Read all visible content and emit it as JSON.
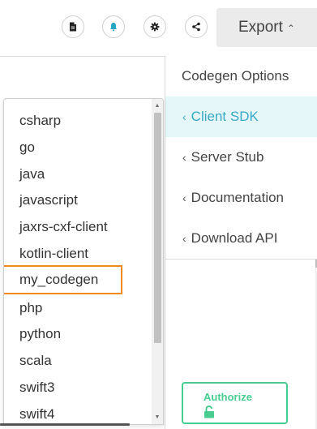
{
  "toolbar": {
    "icons": [
      "document-icon",
      "bell-icon",
      "gear-icon",
      "share-icon"
    ],
    "export_label": "Export",
    "export_caret": "⌃"
  },
  "codegen": {
    "header": "Codegen Options",
    "items": [
      {
        "label": "Client SDK",
        "active": true
      },
      {
        "label": "Server Stub",
        "active": false
      },
      {
        "label": "Documentation",
        "active": false
      },
      {
        "label": "Download API",
        "active": false
      }
    ],
    "chevron": "‹"
  },
  "dropdown": {
    "options": [
      "csharp",
      "go",
      "java",
      "javascript",
      "jaxrs-cxf-client",
      "kotlin-client",
      "my_codegen",
      "php",
      "python",
      "scala",
      "swift3",
      "swift4"
    ],
    "highlighted": "my_codegen",
    "highlight_color": "#f08a24"
  },
  "authorize": {
    "label": "Authorize",
    "color": "#49cc90"
  },
  "colors": {
    "active_bg": "#e6f7f9",
    "active_text": "#3aa9c4"
  }
}
